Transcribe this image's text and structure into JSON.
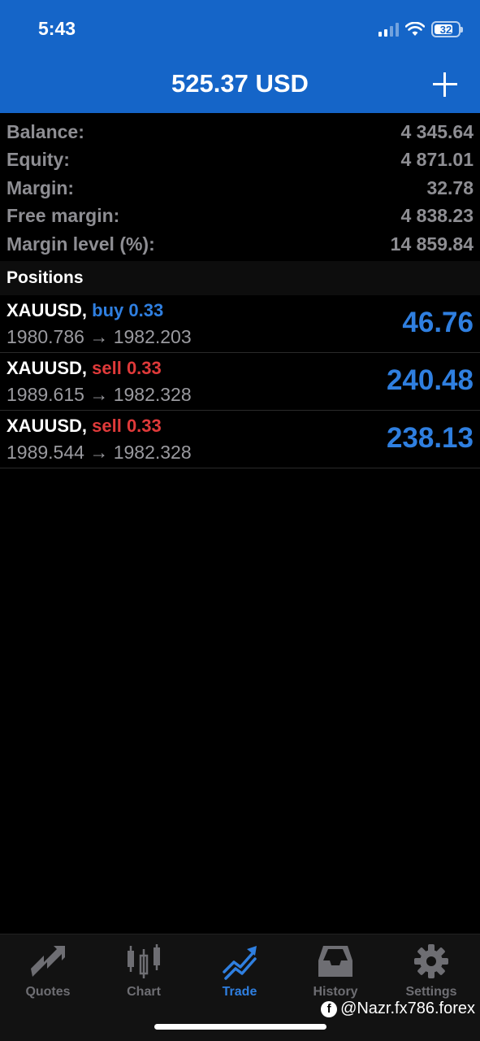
{
  "status_bar": {
    "time": "5:43",
    "battery": "32"
  },
  "header": {
    "title": "525.37 USD",
    "add_icon": "plus-icon"
  },
  "summary": [
    {
      "label": "Balance:",
      "value": "4 345.64"
    },
    {
      "label": "Equity:",
      "value": "4 871.01"
    },
    {
      "label": "Margin:",
      "value": "32.78"
    },
    {
      "label": "Free margin:",
      "value": "4 838.23"
    },
    {
      "label": "Margin level (%):",
      "value": "14 859.84"
    }
  ],
  "positions_header": "Positions",
  "positions": [
    {
      "symbol": "XAUUSD,",
      "type": "buy 0.33",
      "prices": "1980.786 → 1982.203",
      "profit": "46.76"
    },
    {
      "symbol": "XAUUSD,",
      "type": "sell 0.33",
      "prices": "1989.615 → 1982.328",
      "profit": "240.48"
    },
    {
      "symbol": "XAUUSD,",
      "type": "sell 0.33",
      "prices": "1989.544 → 1982.328",
      "profit": "238.13"
    }
  ],
  "tabs": [
    {
      "label": "Quotes",
      "icon": "quotes-icon",
      "active": false
    },
    {
      "label": "Chart",
      "icon": "candlestick-icon",
      "active": false
    },
    {
      "label": "Trade",
      "icon": "trade-icon",
      "active": true
    },
    {
      "label": "History",
      "icon": "inbox-icon",
      "active": false
    },
    {
      "label": "Settings",
      "icon": "gear-icon",
      "active": false
    }
  ],
  "watermark": "@Nazr.fx786.forex",
  "colors": {
    "header": "#1565c8",
    "profit": "#2f7fe0",
    "buy": "#2f7fe0",
    "sell": "#e03a3a",
    "inactive_tab": "#6e6e73"
  }
}
